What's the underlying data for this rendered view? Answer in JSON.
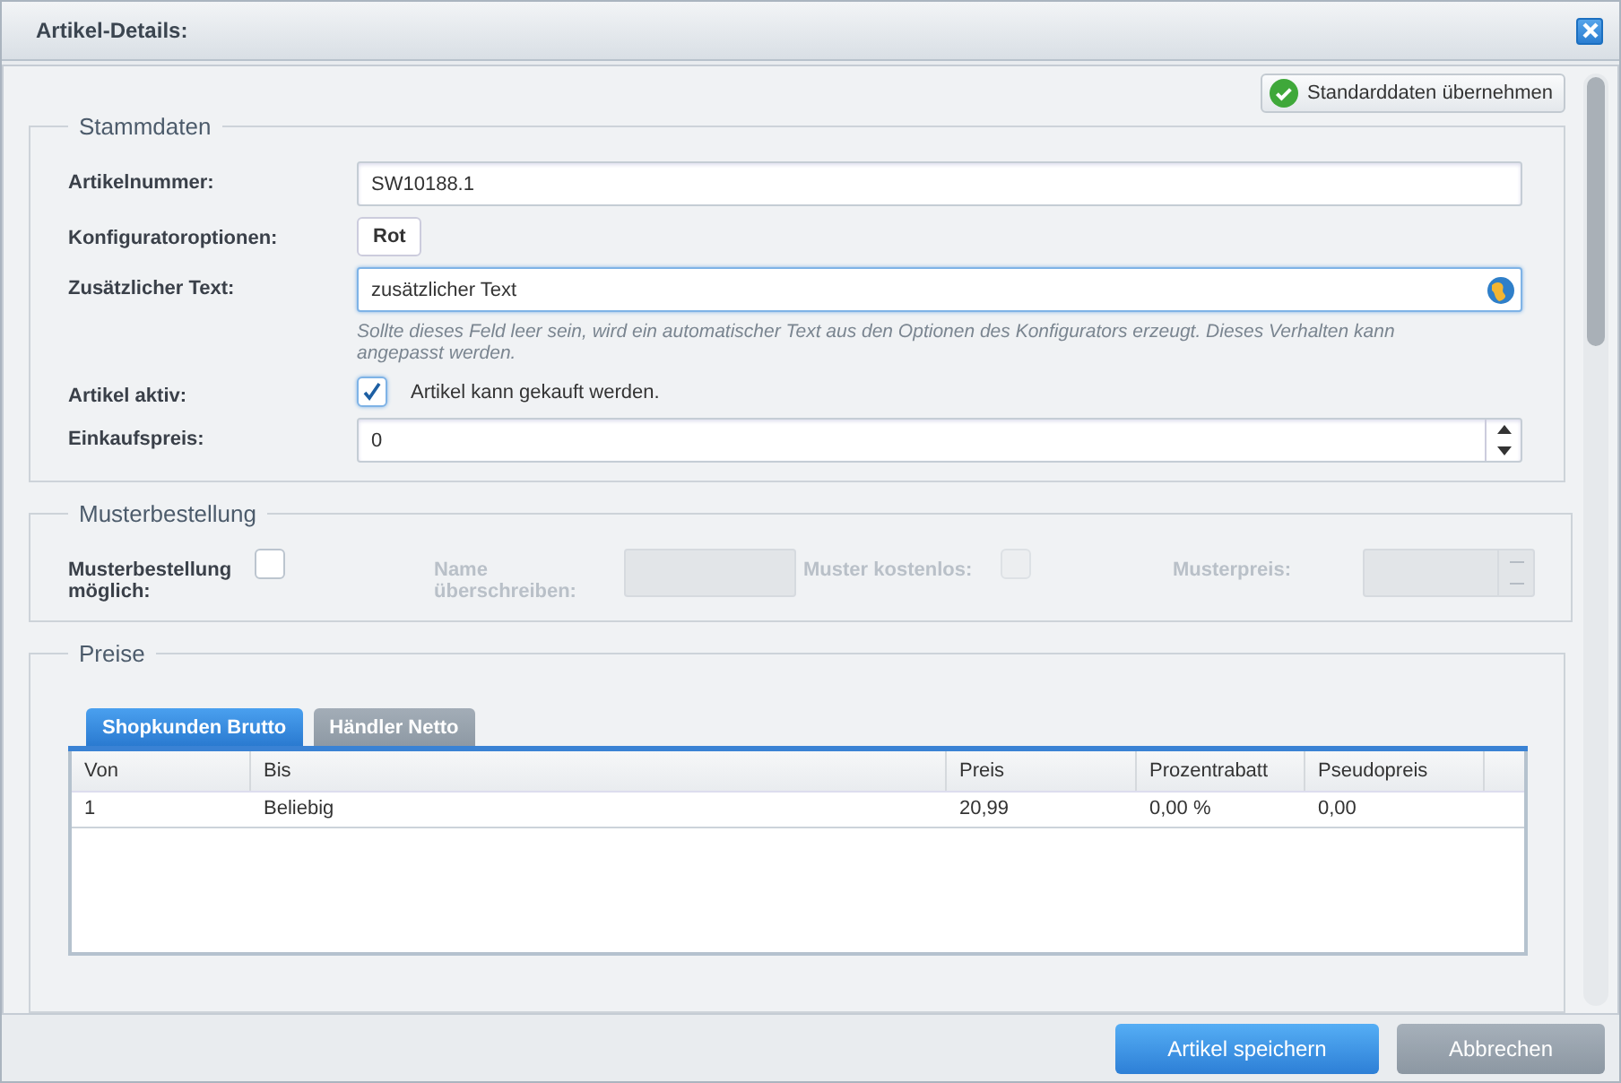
{
  "window": {
    "title": "Artikel-Details:"
  },
  "defaults_button": {
    "label": "Standarddaten übernehmen"
  },
  "stammdaten": {
    "legend": "Stammdaten",
    "fields": [
      {
        "kind": "text",
        "label": "Artikelnummer:",
        "value": "SW10188.1"
      },
      {
        "kind": "tag",
        "label": "Konfiguratoroptionen:",
        "value": "Rot"
      },
      {
        "kind": "translatable",
        "label": "Zusätzlicher Text:",
        "value": "zusätzlicher Text",
        "focused": true,
        "hint": "Sollte dieses Feld leer sein, wird ein automatischer Text aus den Optionen des Konfigurators erzeugt. Dieses Verhalten kann angepasst werden."
      },
      {
        "kind": "checkbox",
        "label": "Artikel aktiv:",
        "checked": true,
        "text": "Artikel kann gekauft werden."
      },
      {
        "kind": "number",
        "label": "Einkaufspreis:",
        "value": "0"
      }
    ]
  },
  "musterbestellung": {
    "legend": "Musterbestellung",
    "fields": [
      {
        "kind": "checkbox",
        "label": "Musterbestellung möglich:",
        "checked": false,
        "disabled": false
      },
      {
        "kind": "text",
        "label": "Name überschreiben:",
        "disabled": true
      },
      {
        "kind": "checkbox",
        "label": "Muster kostenlos:",
        "checked": false,
        "disabled": true
      },
      {
        "kind": "number",
        "label": "Musterpreis:",
        "disabled": true
      }
    ]
  },
  "preise": {
    "legend": "Preise",
    "tabs": [
      {
        "label": "Shopkunden Brutto",
        "selected": true
      },
      {
        "label": "Händler Netto",
        "selected": false
      }
    ],
    "table": {
      "columns": [
        "Von",
        "Bis",
        "Preis",
        "Prozentrabatt",
        "Pseudopreis"
      ],
      "rows": [
        [
          "1",
          "Beliebig",
          "20,99",
          "0,00 %",
          "0,00"
        ]
      ]
    }
  },
  "footer": {
    "buttons": [
      {
        "label": "Artikel speichern",
        "kind": "primary"
      },
      {
        "label": "Abbrechen",
        "kind": "secondary"
      }
    ]
  }
}
